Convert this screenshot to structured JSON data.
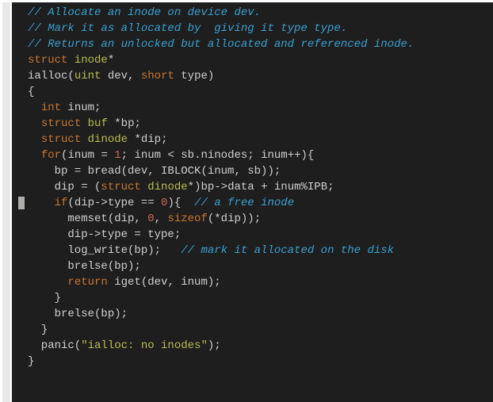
{
  "code": {
    "lines": [
      {
        "seg": [
          {
            "c": "cm",
            "t": "// Allocate an inode on device dev."
          }
        ]
      },
      {
        "seg": [
          {
            "c": "cm",
            "t": "// Mark it as allocated by  giving it type type."
          }
        ]
      },
      {
        "seg": [
          {
            "c": "cm",
            "t": "// Returns an unlocked but allocated and referenced inode."
          }
        ]
      },
      {
        "seg": [
          {
            "c": "kw",
            "t": "struct"
          },
          {
            "c": "id",
            "t": " "
          },
          {
            "c": "ty",
            "t": "inode"
          },
          {
            "c": "op",
            "t": "*"
          }
        ]
      },
      {
        "seg": [
          {
            "c": "fn",
            "t": "ialloc"
          },
          {
            "c": "pn",
            "t": "("
          },
          {
            "c": "ty",
            "t": "uint"
          },
          {
            "c": "id",
            "t": " dev, "
          },
          {
            "c": "kw",
            "t": "short"
          },
          {
            "c": "id",
            "t": " type"
          },
          {
            "c": "pn",
            "t": ")"
          }
        ]
      },
      {
        "seg": [
          {
            "c": "pn",
            "t": "{"
          }
        ]
      },
      {
        "seg": [
          {
            "c": "id",
            "t": "  "
          },
          {
            "c": "kw",
            "t": "int"
          },
          {
            "c": "id",
            "t": " inum;"
          }
        ]
      },
      {
        "seg": [
          {
            "c": "id",
            "t": "  "
          },
          {
            "c": "kw",
            "t": "struct"
          },
          {
            "c": "id",
            "t": " "
          },
          {
            "c": "ty",
            "t": "buf"
          },
          {
            "c": "id",
            "t": " *bp;"
          }
        ]
      },
      {
        "seg": [
          {
            "c": "id",
            "t": "  "
          },
          {
            "c": "kw",
            "t": "struct"
          },
          {
            "c": "id",
            "t": " "
          },
          {
            "c": "ty",
            "t": "dinode"
          },
          {
            "c": "id",
            "t": " *dip;"
          }
        ]
      },
      {
        "seg": [
          {
            "c": "id",
            "t": ""
          }
        ]
      },
      {
        "seg": [
          {
            "c": "id",
            "t": "  "
          },
          {
            "c": "kw",
            "t": "for"
          },
          {
            "c": "pn",
            "t": "("
          },
          {
            "c": "id",
            "t": "inum = "
          },
          {
            "c": "num",
            "t": "1"
          },
          {
            "c": "id",
            "t": "; inum < sb.ninodes; inum++"
          },
          {
            "c": "pn",
            "t": "){"
          }
        ]
      },
      {
        "seg": [
          {
            "c": "id",
            "t": "    bp = bread(dev, IBLOCK(inum, sb));"
          }
        ]
      },
      {
        "seg": [
          {
            "c": "id",
            "t": "    dip = ("
          },
          {
            "c": "kw",
            "t": "struct"
          },
          {
            "c": "id",
            "t": " "
          },
          {
            "c": "ty",
            "t": "dinode"
          },
          {
            "c": "id",
            "t": "*)bp->data + inum%IPB;"
          }
        ]
      },
      {
        "cursor": true,
        "seg": [
          {
            "c": "id",
            "t": "    "
          },
          {
            "c": "kw",
            "t": "if"
          },
          {
            "c": "pn",
            "t": "("
          },
          {
            "c": "id",
            "t": "dip->type == "
          },
          {
            "c": "num",
            "t": "0"
          },
          {
            "c": "pn",
            "t": "){"
          },
          {
            "c": "id",
            "t": "  "
          },
          {
            "c": "cm",
            "t": "// a free inode"
          }
        ]
      },
      {
        "seg": [
          {
            "c": "id",
            "t": "      memset(dip, "
          },
          {
            "c": "num",
            "t": "0"
          },
          {
            "c": "id",
            "t": ", "
          },
          {
            "c": "kw",
            "t": "sizeof"
          },
          {
            "c": "pn",
            "t": "("
          },
          {
            "c": "id",
            "t": "*dip"
          },
          {
            "c": "pn",
            "t": ")"
          },
          {
            "c": "id",
            "t": ");"
          }
        ]
      },
      {
        "seg": [
          {
            "c": "id",
            "t": "      dip->type = type;"
          }
        ]
      },
      {
        "seg": [
          {
            "c": "id",
            "t": "      log_write(bp);   "
          },
          {
            "c": "cm",
            "t": "// mark it allocated on the disk"
          }
        ]
      },
      {
        "seg": [
          {
            "c": "id",
            "t": "      brelse(bp);"
          }
        ]
      },
      {
        "seg": [
          {
            "c": "id",
            "t": "      "
          },
          {
            "c": "kw",
            "t": "return"
          },
          {
            "c": "id",
            "t": " iget(dev, inum);"
          }
        ]
      },
      {
        "seg": [
          {
            "c": "id",
            "t": "    "
          },
          {
            "c": "pn",
            "t": "}"
          }
        ]
      },
      {
        "seg": [
          {
            "c": "id",
            "t": "    brelse(bp);"
          }
        ]
      },
      {
        "seg": [
          {
            "c": "id",
            "t": "  "
          },
          {
            "c": "pn",
            "t": "}"
          }
        ]
      },
      {
        "seg": [
          {
            "c": "id",
            "t": "  panic("
          },
          {
            "c": "str",
            "t": "\"ialloc: no inodes\""
          },
          {
            "c": "id",
            "t": ");"
          }
        ]
      },
      {
        "seg": [
          {
            "c": "pn",
            "t": "}"
          }
        ]
      }
    ]
  }
}
